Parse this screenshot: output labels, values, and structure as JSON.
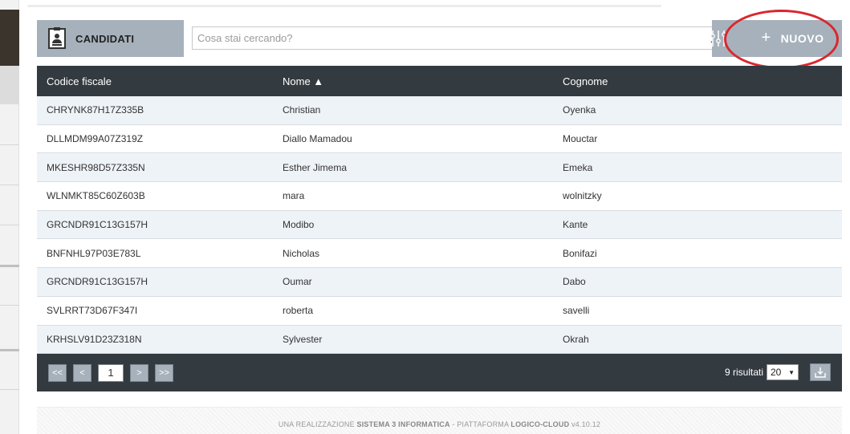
{
  "header": {
    "title": "CANDIDATI",
    "search_placeholder": "Cosa stai cercando?",
    "new_button_label": "NUOVO"
  },
  "table": {
    "columns": [
      "Codice fiscale",
      "Nome ▲",
      "Cognome"
    ],
    "rows": [
      [
        "CHRYNK87H17Z335B",
        "Christian",
        "Oyenka"
      ],
      [
        "DLLMDM99A07Z319Z",
        "Diallo Mamadou",
        "Mouctar"
      ],
      [
        "MKESHR98D57Z335N",
        "Esther Jimema",
        "Emeka"
      ],
      [
        "WLNMKT85C60Z603B",
        "mara",
        "wolnitzky"
      ],
      [
        "GRCNDR91C13G157H",
        "Modibo",
        "Kante"
      ],
      [
        "BNFNHL97P03E783L",
        "Nicholas",
        "Bonifazi"
      ],
      [
        "GRCNDR91C13G157H",
        "Oumar",
        "Dabo"
      ],
      [
        "SVLRRT73D67F347I",
        "roberta",
        "savelli"
      ],
      [
        "KRHSLV91D23Z318N",
        "Sylvester",
        "Okrah"
      ]
    ]
  },
  "pagination": {
    "first": "<<",
    "prev": "<",
    "current_page": "1",
    "next": ">",
    "last": ">>",
    "results_text": "9 risultati",
    "page_size": "20"
  },
  "footer": {
    "prefix": "UNA REALIZZAZIONE ",
    "company": "SISTEMA 3 INFORMATICA",
    "middle": " - PIATTAFORMA ",
    "platform": "LOGICO-CLOUD",
    "version": " v4.10.12"
  },
  "colors": {
    "header_bg": "#a7b1bb",
    "table_header_bg": "#333a40",
    "row_alt_bg": "#eef3f8",
    "highlight_ellipse": "#d9272e"
  },
  "icons": [
    "candidate-badge-icon",
    "search-icon",
    "filter-icon",
    "plus-icon",
    "download-icon",
    "dropdown-arrow-icon"
  ]
}
